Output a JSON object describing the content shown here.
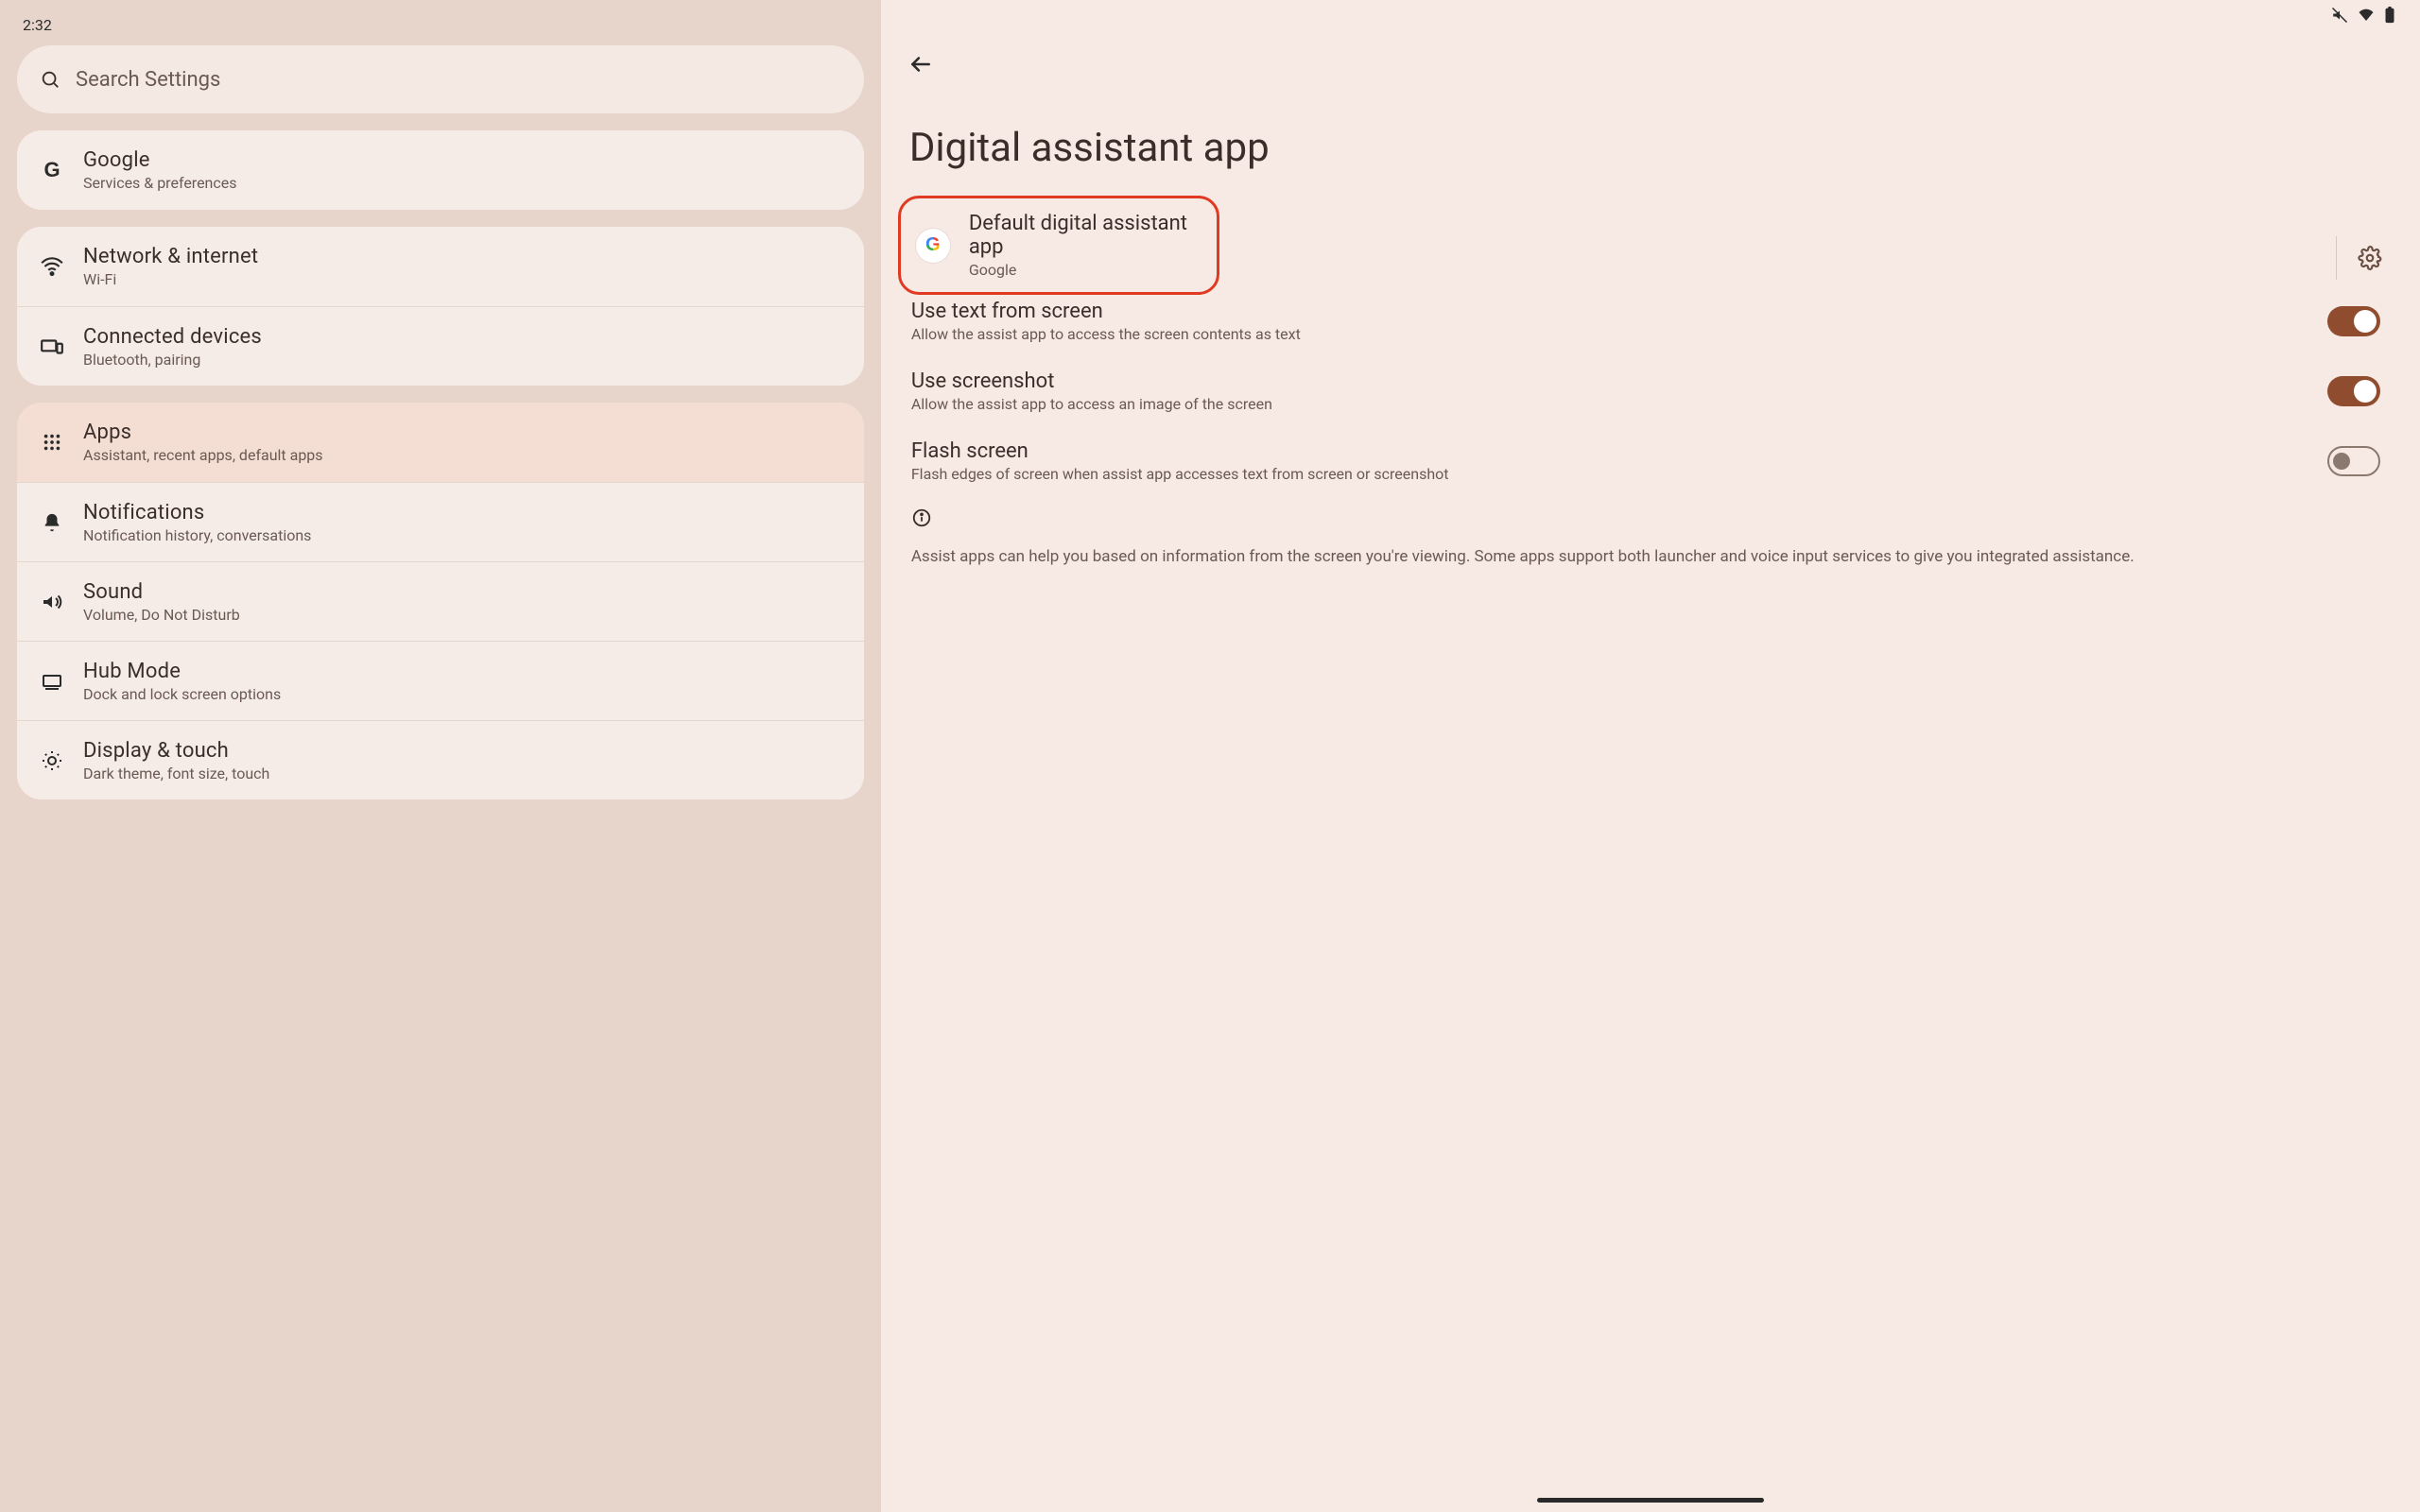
{
  "status": {
    "time": "2:32"
  },
  "search": {
    "placeholder": "Search Settings"
  },
  "sidebar": {
    "google": {
      "title": "Google",
      "subtitle": "Services & preferences"
    },
    "items": [
      {
        "id": "network",
        "title": "Network & internet",
        "subtitle": "Wi-Fi"
      },
      {
        "id": "devices",
        "title": "Connected devices",
        "subtitle": "Bluetooth, pairing"
      },
      {
        "id": "apps",
        "title": "Apps",
        "subtitle": "Assistant, recent apps, default apps"
      },
      {
        "id": "notifications",
        "title": "Notifications",
        "subtitle": "Notification history, conversations"
      },
      {
        "id": "sound",
        "title": "Sound",
        "subtitle": "Volume, Do Not Disturb"
      },
      {
        "id": "hub",
        "title": "Hub Mode",
        "subtitle": "Dock and lock screen options"
      },
      {
        "id": "display",
        "title": "Display & touch",
        "subtitle": "Dark theme, font size, touch"
      }
    ]
  },
  "page": {
    "title": "Digital assistant app",
    "default_assistant": {
      "title": "Default digital assistant app",
      "value": "Google"
    },
    "rows": {
      "use_text": {
        "title": "Use text from screen",
        "subtitle": "Allow the assist app to access the screen contents as text",
        "on": true
      },
      "screenshot": {
        "title": "Use screenshot",
        "subtitle": "Allow the assist app to access an image of the screen",
        "on": true
      },
      "flash": {
        "title": "Flash screen",
        "subtitle": "Flash edges of screen when assist app accesses text from screen or screenshot",
        "on": false
      }
    },
    "description": "Assist apps can help you based on information from the screen you're viewing. Some apps support both launcher and voice input services to give you integrated assistance."
  }
}
